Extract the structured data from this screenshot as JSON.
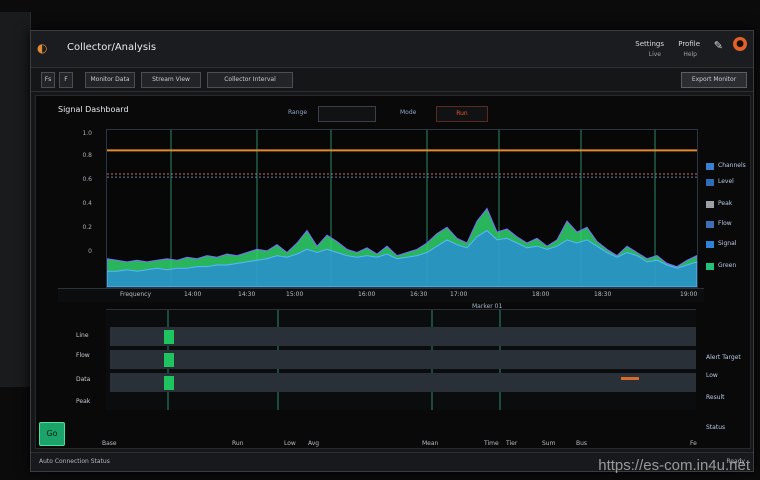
{
  "app": {
    "title": "Collector/Analysis",
    "icon": "app-icon",
    "toolbar_top": {
      "btn1": "Settings",
      "btn1_sub": "Live",
      "btn2": "Profile",
      "btn2_sub": "Help",
      "edit_icon": "pencil-icon",
      "logo_icon": "brand-logo-icon"
    }
  },
  "toolbar": {
    "items": [
      "Fs",
      "F",
      "Monitor Data",
      "Stream View",
      "Collector Interval"
    ],
    "right_button": "Export Monitor"
  },
  "panel": {
    "title": "Signal Dashboard",
    "range_label": "Range",
    "range_value": "",
    "mode_label": "Mode",
    "mode_value": "Run",
    "mode_color": "#e5542e"
  },
  "y_ticks": [
    "1.0",
    "0.8",
    "0.6",
    "0.4",
    "0.2",
    "0"
  ],
  "legend": [
    {
      "label": "Channels",
      "color": "#3a7fd0"
    },
    {
      "label": "Level",
      "color": "#2f6db8"
    },
    {
      "label": "Peak",
      "color": "#9aa0a6"
    },
    {
      "label": "Flow",
      "color": "#3c6fb5"
    },
    {
      "label": "Signal",
      "color": "#2f83d6"
    },
    {
      "label": "Green",
      "color": "#22c27a"
    }
  ],
  "x_ticks": [
    "Frequency",
    "14:00",
    "14:30",
    "15:00",
    "16:00",
    "16:30",
    "17:00",
    "18:00",
    "18:30",
    "19:00"
  ],
  "marker_label": "Marker 01",
  "chart_data": {
    "type": "area",
    "series": [
      {
        "values": [
          0.18,
          0.17,
          0.16,
          0.17,
          0.16,
          0.17,
          0.18,
          0.17,
          0.19,
          0.18,
          0.2,
          0.19,
          0.21,
          0.2,
          0.22,
          0.24,
          0.23,
          0.27,
          0.22,
          0.28,
          0.36,
          0.26,
          0.33,
          0.29,
          0.24,
          0.22,
          0.25,
          0.21,
          0.26,
          0.2,
          0.22,
          0.24,
          0.28,
          0.34,
          0.38,
          0.31,
          0.28,
          0.42,
          0.5,
          0.35,
          0.37,
          0.32,
          0.28,
          0.31,
          0.26,
          0.3,
          0.42,
          0.35,
          0.38,
          0.29,
          0.24,
          0.2,
          0.26,
          0.22,
          0.18,
          0.2,
          0.15,
          0.13,
          0.17,
          0.2
        ],
        "color": "#2fd36a"
      },
      {
        "values": [
          0.1,
          0.1,
          0.11,
          0.1,
          0.11,
          0.12,
          0.11,
          0.12,
          0.12,
          0.13,
          0.13,
          0.14,
          0.14,
          0.15,
          0.16,
          0.17,
          0.18,
          0.2,
          0.19,
          0.21,
          0.24,
          0.22,
          0.24,
          0.22,
          0.2,
          0.19,
          0.2,
          0.19,
          0.21,
          0.18,
          0.19,
          0.2,
          0.22,
          0.26,
          0.3,
          0.27,
          0.25,
          0.32,
          0.36,
          0.3,
          0.31,
          0.28,
          0.25,
          0.26,
          0.24,
          0.26,
          0.3,
          0.28,
          0.3,
          0.26,
          0.22,
          0.19,
          0.22,
          0.2,
          0.16,
          0.17,
          0.14,
          0.12,
          0.14,
          0.16
        ],
        "color": "#2a8be0"
      }
    ],
    "lines": [
      {
        "value": 0.87,
        "color": "#e3892e"
      },
      {
        "value": 0.72,
        "color": "#b87272"
      },
      {
        "value": 0.7,
        "color": "#6e7c8a"
      }
    ],
    "ylim": [
      0,
      1
    ],
    "grid": true
  },
  "track": {
    "labels": [
      "Line",
      "Flow",
      "Data",
      "Peak"
    ],
    "legend": [
      "Alert Target",
      "Low",
      "Result",
      "Status"
    ]
  },
  "bottom_ticks": [
    "Base",
    "Run",
    "Low",
    "Avg",
    "Mean",
    "Time",
    "Tier",
    "Sum",
    "Bus",
    "Fe"
  ],
  "green_button_label": "Go",
  "status": {
    "left": "Auto Connection Status",
    "right": "Ready"
  },
  "watermark": "https://es-com.in4u.net"
}
